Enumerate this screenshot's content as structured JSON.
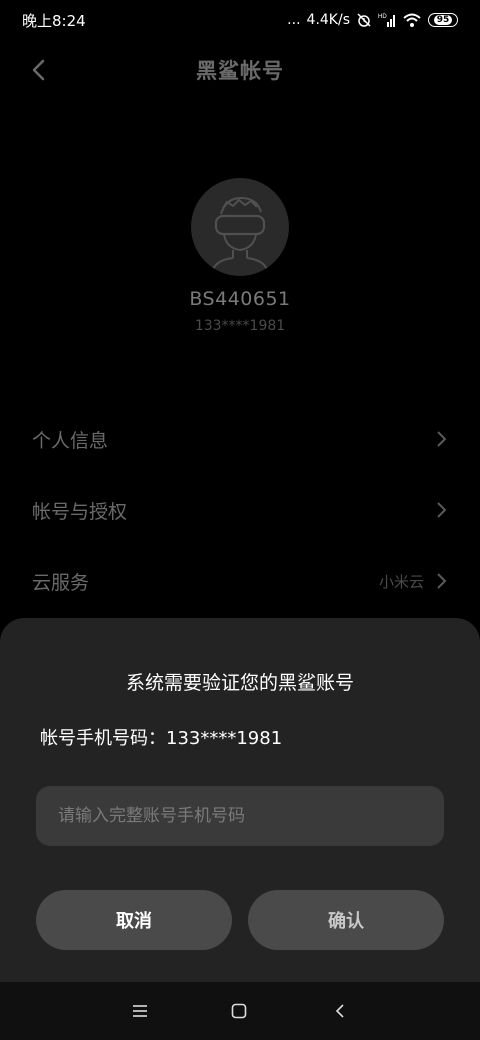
{
  "status_bar": {
    "time": "晚上8:24",
    "dots": "...",
    "network_speed": "4.4K/s",
    "battery_level": "95",
    "icons": [
      "alarm-off-icon",
      "signal-hd-icon",
      "wifi-icon",
      "battery-icon"
    ]
  },
  "header": {
    "title": "黑鲨帐号",
    "back_icon": "back-arrow-icon"
  },
  "profile": {
    "avatar_icon": "vr-headset-avatar-icon",
    "username": "BS440651",
    "phone_masked": "133****1981"
  },
  "menu": {
    "items": [
      {
        "label": "个人信息",
        "value": ""
      },
      {
        "label": "帐号与授权",
        "value": ""
      },
      {
        "label": "云服务",
        "value": "小米云"
      }
    ]
  },
  "dialog": {
    "title": "系统需要验证您的黑鲨账号",
    "phone_label": "帐号手机号码：133****1981",
    "input_placeholder": "请输入完整账号手机号码",
    "input_value": "",
    "cancel_label": "取消",
    "confirm_label": "确认"
  },
  "nav_bar": {
    "icons": [
      "menu-icon",
      "home-icon",
      "back-icon"
    ]
  },
  "colors": {
    "background": "#000000",
    "sheet": "#232323",
    "input": "#3a3a3a",
    "button": "#4a4a4a"
  }
}
